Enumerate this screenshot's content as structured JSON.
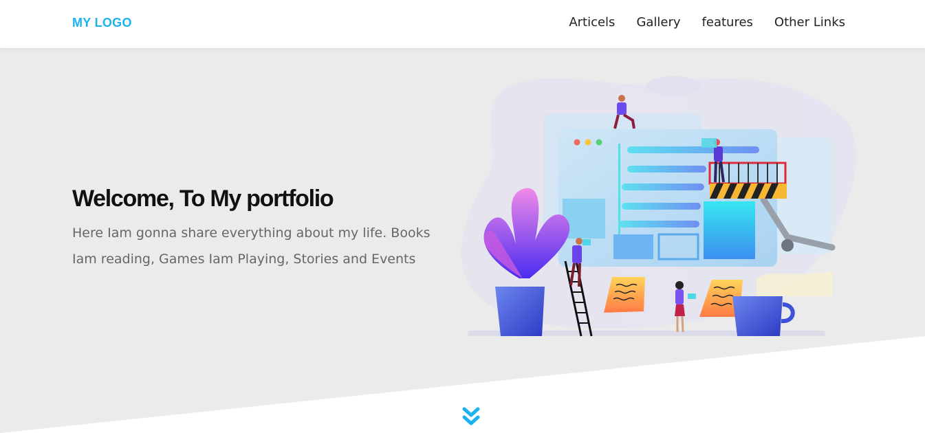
{
  "navbar": {
    "logo": "MY LOGO",
    "links": [
      {
        "label": "Articels"
      },
      {
        "label": "Gallery"
      },
      {
        "label": "features"
      },
      {
        "label": "Other Links"
      }
    ]
  },
  "hero": {
    "title": "Welcome, To My portfolio",
    "text": "Here Iam gonna share everything about my life. Books Iam reading, Games Iam Playing, Stories and Events",
    "scroll_icon": "double-chevron-down-icon"
  },
  "colors": {
    "accent": "#1ab3f0",
    "hero_background": "#ebebeb",
    "text": "#666666"
  }
}
